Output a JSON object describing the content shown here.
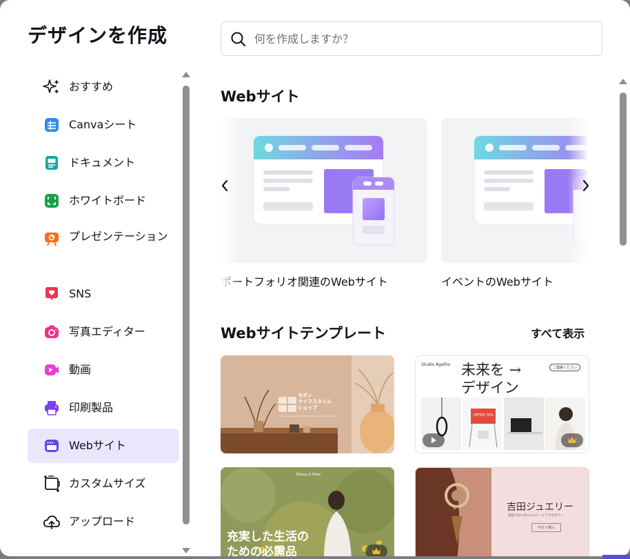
{
  "dialog": {
    "title": "デザインを作成"
  },
  "search": {
    "placeholder": "何を作成しますか？"
  },
  "sidebar": {
    "items": [
      {
        "label": "おすすめ",
        "icon": "sparkles-icon"
      },
      {
        "label": "Canvaシート",
        "icon": "sheet-icon"
      },
      {
        "label": "ドキュメント",
        "icon": "document-icon"
      },
      {
        "label": "ホワイトボード",
        "icon": "whiteboard-icon"
      },
      {
        "label": "プレゼンテーション",
        "icon": "presentation-icon"
      },
      {
        "label": "SNS",
        "icon": "heart-icon"
      },
      {
        "label": "写真エディター",
        "icon": "camera-icon"
      },
      {
        "label": "動画",
        "icon": "video-icon"
      },
      {
        "label": "印刷製品",
        "icon": "printer-icon"
      },
      {
        "label": "Webサイト",
        "icon": "website-icon",
        "active": true
      },
      {
        "label": "カスタムサイズ",
        "icon": "resize-icon"
      },
      {
        "label": "アップロード",
        "icon": "cloud-upload-icon"
      }
    ]
  },
  "main": {
    "website_section": {
      "title": "Webサイト"
    },
    "carousel": [
      {
        "caption": "ポートフォリオ関連のWebサイト"
      },
      {
        "caption": "イベントのWebサイト"
      }
    ],
    "templates_section": {
      "title": "Webサイトテンプレート",
      "see_all": "すべて表示"
    },
    "templates": {
      "t1": {
        "text": "モダン\nライフスタイル\nショップ"
      },
      "t2": {
        "brand": "Studio Agatho",
        "heading1": "未来を →",
        "heading2": "デザイン",
        "pill": "ご連絡ください",
        "screen": "OFFER 70%"
      },
      "t3": {
        "brand": "Ebony & Olive",
        "line1": "充実した生活の",
        "line2": "ための必需品"
      },
      "t4": {
        "heading": "吉田ジュエリー",
        "sub": "普段づかいのジュエリーとアクセサリー",
        "button": "今すぐ購入"
      }
    }
  },
  "colors": {
    "accent": "#8b3dff",
    "active_bg": "#ece6fd",
    "text": "#0e1318"
  }
}
